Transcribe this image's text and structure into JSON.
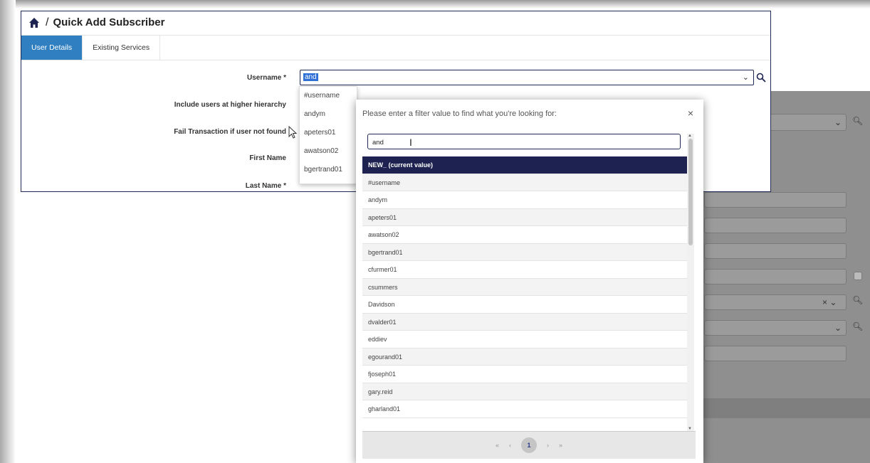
{
  "header": {
    "title": "Quick Add Subscriber",
    "separator": "/"
  },
  "tabs": [
    {
      "label": "User Details",
      "active": true
    },
    {
      "label": "Existing Services",
      "active": false
    }
  ],
  "form": {
    "username_label": "Username *",
    "username_value": "and",
    "higher_hierarchy_label": "Include users at higher hierarchy",
    "fail_label": "Fail Transaction if user not found",
    "first_name_label": "First Name",
    "last_name_label": "Last Name *"
  },
  "dropdown_items": [
    "#username",
    "andym",
    "apeters01",
    "awatson02",
    "bgertrand01"
  ],
  "modal": {
    "title": "Please enter a filter value to find what you're looking for:",
    "close": "×",
    "filter_value": "and",
    "rows": [
      "NEW_ (current value)",
      "#username",
      "andym",
      "apeters01",
      "awatson02",
      "bgertrand01",
      "cfurmer01",
      "csummers",
      "Davidson",
      "dvalder01",
      "eddiev",
      "egourand01",
      "fjoseph01",
      "gary.reid",
      "gharland01"
    ],
    "pager": {
      "first": "«",
      "prev": "‹",
      "page": "1",
      "next": "›",
      "last": "»"
    }
  },
  "colors": {
    "accent": "#2f7fc1",
    "navy": "#1d2250"
  }
}
